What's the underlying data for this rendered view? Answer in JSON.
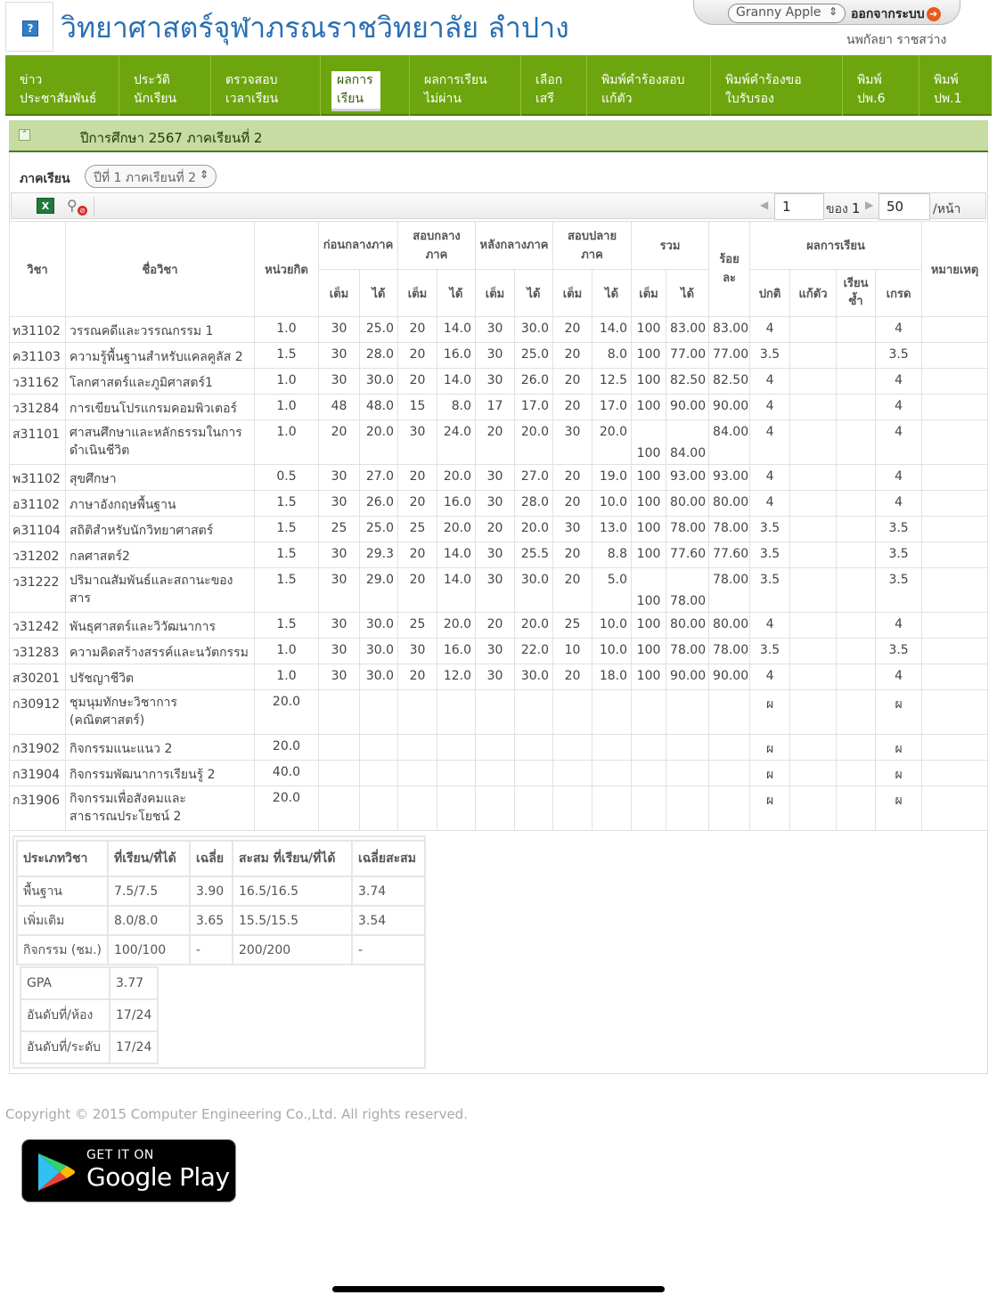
{
  "header": {
    "title": "วิทยาศาสตร์จุฬาภรณราชวิทยาลัย ลำปาง",
    "theme": "Granny Apple",
    "logout": "ออกจากระบบ",
    "user": "นพกัลยา ราชสว่าง"
  },
  "nav": [
    {
      "l1": "ข่าว",
      "l2": "ประชาสัมพันธ์"
    },
    {
      "l1": "ประวัติ",
      "l2": "นักเรียน"
    },
    {
      "l1": "ตรวจสอบ",
      "l2": "เวลาเรียน"
    },
    {
      "l1": "ผลการ",
      "l2": "เรียน"
    },
    {
      "l1": "ผลการเรียน",
      "l2": "ไม่ผ่าน"
    },
    {
      "l1": "เลือก",
      "l2": "เสรี"
    },
    {
      "l1": "พิมพ์คำร้องสอบ",
      "l2": "แก้ตัว"
    },
    {
      "l1": "พิมพ์คำร้องขอ",
      "l2": "ใบรับรอง"
    },
    {
      "l1": "พิมพ์",
      "l2": "ปพ.6"
    },
    {
      "l1": "พิมพ์",
      "l2": "ปพ.1"
    }
  ],
  "section": {
    "title": "ปีการศึกษา 2567 ภาคเรียนที่ 2"
  },
  "filter": {
    "label": "ภาคเรียน",
    "value": "ปีที่ 1 ภาคเรียนที่ 2"
  },
  "pager": {
    "page": "1",
    "of_label": "ของ",
    "total": "1",
    "size": "50",
    "unit": "/หน้า"
  },
  "table": {
    "h_code": "วิชา",
    "h_name": "ชื่อวิชา",
    "h_credit": "หน่วยกิต",
    "h_pre": "ก่อนกลางภาค",
    "h_mid": "สอบกลางภาค",
    "h_post": "หลังกลางภาค",
    "h_final": "สอบปลายภาค",
    "h_total": "รวม",
    "h_percent": "ร้อยละ",
    "h_result": "ผลการเรียน",
    "h_remark": "หมายเหตุ",
    "h_full": "เต็ม",
    "h_got": "ได้",
    "h_normal": "ปกติ",
    "h_retest": "แก้ตัว",
    "h_repeat": "เรียนซ้ำ",
    "h_grade": "เกรด",
    "rows": [
      {
        "code": "ท31102",
        "name": "วรรณคดีและวรรณกรรม 1",
        "credit": "1.0",
        "pre_f": "30",
        "pre_g": "25.0",
        "mid_f": "20",
        "mid_g": "14.0",
        "post_f": "30",
        "post_g": "30.0",
        "fin_f": "20",
        "fin_g": "14.0",
        "tot_f": "100",
        "tot_g": "83.00",
        "pct": "83.00",
        "normal": "4",
        "retest": "",
        "repeat": "",
        "grade": "4",
        "remark": ""
      },
      {
        "code": "ค31103",
        "name": "ความรู้พื้นฐานสำหรับแคลคูลัส 2",
        "credit": "1.5",
        "pre_f": "30",
        "pre_g": "28.0",
        "mid_f": "20",
        "mid_g": "16.0",
        "post_f": "30",
        "post_g": "25.0",
        "fin_f": "20",
        "fin_g": "8.0",
        "tot_f": "100",
        "tot_g": "77.00",
        "pct": "77.00",
        "normal": "3.5",
        "retest": "",
        "repeat": "",
        "grade": "3.5",
        "remark": ""
      },
      {
        "code": "ว31162",
        "name": "โลกศาสตร์และภูมิศาสตร์1",
        "credit": "1.0",
        "pre_f": "30",
        "pre_g": "30.0",
        "mid_f": "20",
        "mid_g": "14.0",
        "post_f": "30",
        "post_g": "26.0",
        "fin_f": "20",
        "fin_g": "12.5",
        "tot_f": "100",
        "tot_g": "82.50",
        "pct": "82.50",
        "normal": "4",
        "retest": "",
        "repeat": "",
        "grade": "4",
        "remark": ""
      },
      {
        "code": "ว31284",
        "name": "การเขียนโปรแกรมคอมพิวเตอร์",
        "credit": "1.0",
        "pre_f": "48",
        "pre_g": "48.0",
        "mid_f": "15",
        "mid_g": "8.0",
        "post_f": "17",
        "post_g": "17.0",
        "fin_f": "20",
        "fin_g": "17.0",
        "tot_f": "100",
        "tot_g": "90.00",
        "pct": "90.00",
        "normal": "4",
        "retest": "",
        "repeat": "",
        "grade": "4",
        "remark": ""
      },
      {
        "code": "ส31101",
        "name": "ศาสนศึกษาและหลักธรรมในการดำเนินชีวิต",
        "credit": "1.0",
        "pre_f": "20",
        "pre_g": "20.0",
        "mid_f": "30",
        "mid_g": "24.0",
        "post_f": "20",
        "post_g": "20.0",
        "fin_f": "30",
        "fin_g": "20.0",
        "tot_f": "100",
        "tot_g": "84.00",
        "pct": "84.00",
        "normal": "4",
        "retest": "",
        "repeat": "",
        "grade": "4",
        "remark": ""
      },
      {
        "code": "พ31102",
        "name": "สุขศึกษา",
        "credit": "0.5",
        "pre_f": "30",
        "pre_g": "27.0",
        "mid_f": "20",
        "mid_g": "20.0",
        "post_f": "30",
        "post_g": "27.0",
        "fin_f": "20",
        "fin_g": "19.0",
        "tot_f": "100",
        "tot_g": "93.00",
        "pct": "93.00",
        "normal": "4",
        "retest": "",
        "repeat": "",
        "grade": "4",
        "remark": ""
      },
      {
        "code": "อ31102",
        "name": "ภาษาอังกฤษพื้นฐาน",
        "credit": "1.5",
        "pre_f": "30",
        "pre_g": "26.0",
        "mid_f": "20",
        "mid_g": "16.0",
        "post_f": "30",
        "post_g": "28.0",
        "fin_f": "20",
        "fin_g": "10.0",
        "tot_f": "100",
        "tot_g": "80.00",
        "pct": "80.00",
        "normal": "4",
        "retest": "",
        "repeat": "",
        "grade": "4",
        "remark": ""
      },
      {
        "code": "ค31104",
        "name": "สถิติสำหรับนักวิทยาศาสตร์",
        "credit": "1.5",
        "pre_f": "25",
        "pre_g": "25.0",
        "mid_f": "25",
        "mid_g": "20.0",
        "post_f": "20",
        "post_g": "20.0",
        "fin_f": "30",
        "fin_g": "13.0",
        "tot_f": "100",
        "tot_g": "78.00",
        "pct": "78.00",
        "normal": "3.5",
        "retest": "",
        "repeat": "",
        "grade": "3.5",
        "remark": ""
      },
      {
        "code": "ว31202",
        "name": "กลศาสตร์2",
        "credit": "1.5",
        "pre_f": "30",
        "pre_g": "29.3",
        "mid_f": "20",
        "mid_g": "14.0",
        "post_f": "30",
        "post_g": "25.5",
        "fin_f": "20",
        "fin_g": "8.8",
        "tot_f": "100",
        "tot_g": "77.60",
        "pct": "77.60",
        "normal": "3.5",
        "retest": "",
        "repeat": "",
        "grade": "3.5",
        "remark": ""
      },
      {
        "code": "ว31222",
        "name": "ปริมาณสัมพันธ์และสถานะของสาร",
        "credit": "1.5",
        "pre_f": "30",
        "pre_g": "29.0",
        "mid_f": "20",
        "mid_g": "14.0",
        "post_f": "30",
        "post_g": "30.0",
        "fin_f": "20",
        "fin_g": "5.0",
        "tot_f": "100",
        "tot_g": "78.00",
        "pct": "78.00",
        "normal": "3.5",
        "retest": "",
        "repeat": "",
        "grade": "3.5",
        "remark": ""
      },
      {
        "code": "ว31242",
        "name": "พันธุศาสตร์และวิวัฒนาการ",
        "credit": "1.5",
        "pre_f": "30",
        "pre_g": "30.0",
        "mid_f": "25",
        "mid_g": "20.0",
        "post_f": "20",
        "post_g": "20.0",
        "fin_f": "25",
        "fin_g": "10.0",
        "tot_f": "100",
        "tot_g": "80.00",
        "pct": "80.00",
        "normal": "4",
        "retest": "",
        "repeat": "",
        "grade": "4",
        "remark": ""
      },
      {
        "code": "ว31283",
        "name": "ความคิดสร้างสรรค์และนวัตกรรม",
        "credit": "1.0",
        "pre_f": "30",
        "pre_g": "30.0",
        "mid_f": "30",
        "mid_g": "16.0",
        "post_f": "30",
        "post_g": "22.0",
        "fin_f": "10",
        "fin_g": "10.0",
        "tot_f": "100",
        "tot_g": "78.00",
        "pct": "78.00",
        "normal": "3.5",
        "retest": "",
        "repeat": "",
        "grade": "3.5",
        "remark": ""
      },
      {
        "code": "ส30201",
        "name": "ปรัชญาชีวิต",
        "credit": "1.0",
        "pre_f": "30",
        "pre_g": "30.0",
        "mid_f": "20",
        "mid_g": "12.0",
        "post_f": "30",
        "post_g": "30.0",
        "fin_f": "20",
        "fin_g": "18.0",
        "tot_f": "100",
        "tot_g": "90.00",
        "pct": "90.00",
        "normal": "4",
        "retest": "",
        "repeat": "",
        "grade": "4",
        "remark": ""
      },
      {
        "code": "ก30912",
        "name": "ชุมนุมทักษะวิชาการ (คณิตศาสตร์)",
        "credit": "20.0",
        "pre_f": "",
        "pre_g": "",
        "mid_f": "",
        "mid_g": "",
        "post_f": "",
        "post_g": "",
        "fin_f": "",
        "fin_g": "",
        "tot_f": "",
        "tot_g": "",
        "pct": "",
        "normal": "ผ",
        "retest": "",
        "repeat": "",
        "grade": "ผ",
        "remark": ""
      },
      {
        "code": "ก31902",
        "name": "กิจกรรมแนะแนว 2",
        "credit": "20.0",
        "pre_f": "",
        "pre_g": "",
        "mid_f": "",
        "mid_g": "",
        "post_f": "",
        "post_g": "",
        "fin_f": "",
        "fin_g": "",
        "tot_f": "",
        "tot_g": "",
        "pct": "",
        "normal": "ผ",
        "retest": "",
        "repeat": "",
        "grade": "ผ",
        "remark": ""
      },
      {
        "code": "ก31904",
        "name": "กิจกรรมพัฒนาการเรียนรู้ 2",
        "credit": "40.0",
        "pre_f": "",
        "pre_g": "",
        "mid_f": "",
        "mid_g": "",
        "post_f": "",
        "post_g": "",
        "fin_f": "",
        "fin_g": "",
        "tot_f": "",
        "tot_g": "",
        "pct": "",
        "normal": "ผ",
        "retest": "",
        "repeat": "",
        "grade": "ผ",
        "remark": ""
      },
      {
        "code": "ก31906",
        "name": "กิจกรรมเพื่อสังคมและสาธารณประโยชน์ 2",
        "credit": "20.0",
        "pre_f": "",
        "pre_g": "",
        "mid_f": "",
        "mid_g": "",
        "post_f": "",
        "post_g": "",
        "fin_f": "",
        "fin_g": "",
        "tot_f": "",
        "tot_g": "",
        "pct": "",
        "normal": "ผ",
        "retest": "",
        "repeat": "",
        "grade": "ผ",
        "remark": ""
      }
    ]
  },
  "summary": {
    "headers": [
      "ประเภทวิชา",
      "ที่เรียน/ที่ได้",
      "เฉลี่ย",
      "สะสม ที่เรียน/ที่ได้",
      "เฉลี่ยสะสม"
    ],
    "rows": [
      [
        "พื้นฐาน",
        "7.5/7.5",
        "3.90",
        "16.5/16.5",
        "3.74"
      ],
      [
        "เพิ่มเติม",
        "8.0/8.0",
        "3.65",
        "15.5/15.5",
        "3.54"
      ],
      [
        "กิจกรรม (ชม.)",
        "100/100",
        "-",
        "200/200",
        "-"
      ]
    ],
    "gpa": [
      [
        "GPA",
        "3.77"
      ],
      [
        "อันดับที่/ห้อง",
        "17/24"
      ],
      [
        "อันดับที่/ระดับ",
        "17/24"
      ]
    ]
  },
  "footer": {
    "copyright": "Copyright © 2015 Computer Engineering Co.,Ltd. All rights reserved.",
    "gplay_top": "GET IT ON",
    "gplay_main": "Google Play"
  },
  "colors": {
    "nav": "#6da50f",
    "section": "#c6dca2",
    "title": "#2a6fb3"
  }
}
